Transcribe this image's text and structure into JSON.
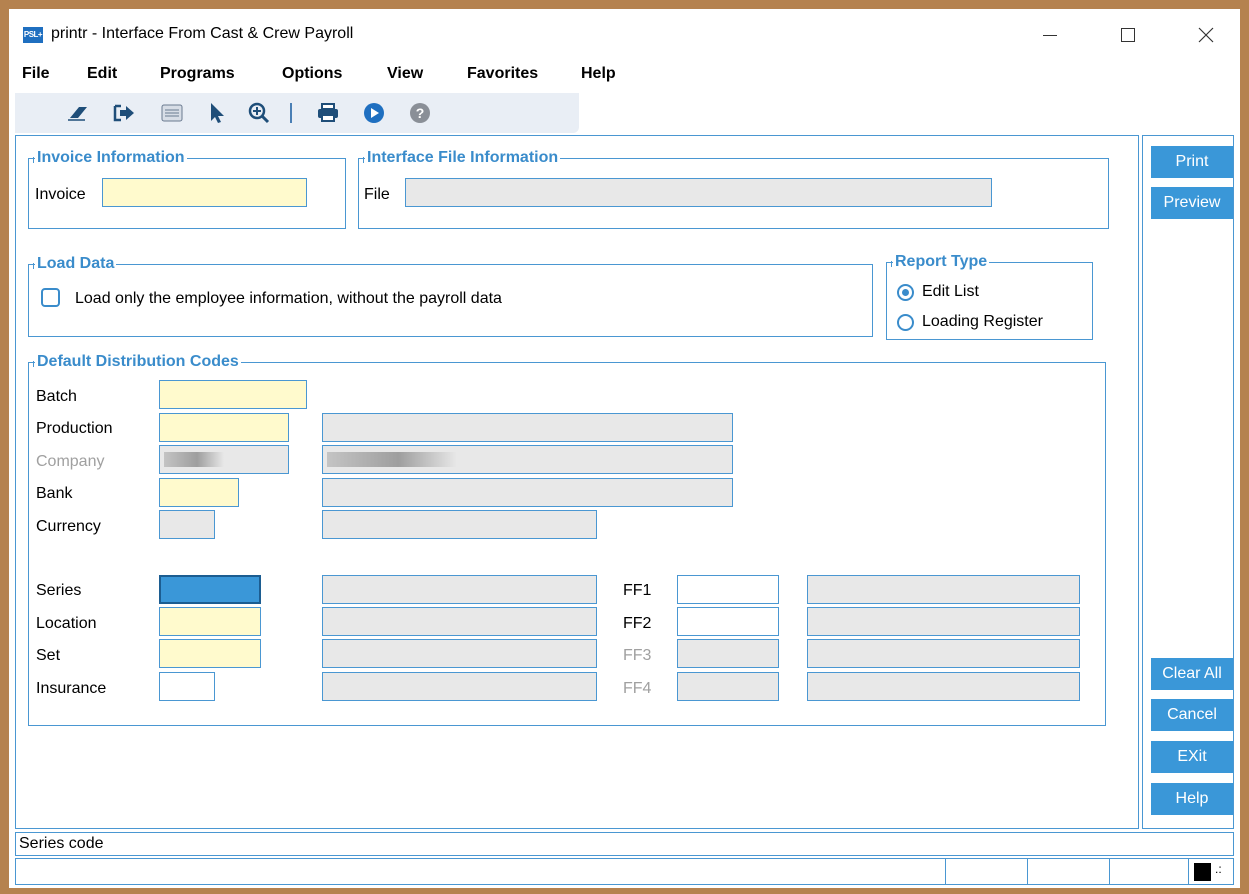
{
  "window": {
    "title": "printr - Interface From Cast & Crew Payroll",
    "app_icon_text": "PSL+"
  },
  "menu": [
    "File",
    "Edit",
    "Programs",
    "Options",
    "View",
    "Favorites",
    "Help"
  ],
  "toolbar_icons": [
    "eraser-icon",
    "exit-arrow-icon",
    "list-icon",
    "pointer-icon",
    "zoom-in-icon",
    "print-icon",
    "run-icon",
    "help-icon"
  ],
  "invoice_group": {
    "title": "Invoice Information",
    "invoice_label": "Invoice",
    "invoice_value": ""
  },
  "file_group": {
    "title": "Interface File Information",
    "file_label": "File",
    "file_value": ""
  },
  "load_group": {
    "title": "Load Data",
    "checkbox_label": "Load only the employee information, without the payroll data",
    "checked": false
  },
  "report_group": {
    "title": "Report Type",
    "options": [
      "Edit List",
      "Loading Register"
    ],
    "selected": "Edit List"
  },
  "dist_group": {
    "title": "Default Distribution Codes",
    "batch": "Batch",
    "production": "Production",
    "company": "Company",
    "bank": "Bank",
    "currency": "Currency",
    "series": "Series",
    "location": "Location",
    "set": "Set",
    "insurance": "Insurance",
    "ff1": "FF1",
    "ff2": "FF2",
    "ff3": "FF3",
    "ff4": "FF4"
  },
  "side_buttons": {
    "print": "Print",
    "preview": "Preview",
    "clear_all": "Clear All",
    "cancel": "Cancel",
    "exit": "EXit",
    "help": "Help"
  },
  "status": {
    "message": "Series code"
  },
  "colors": {
    "accent": "#3a97d8",
    "required_field": "#fffacd",
    "readonly_field": "#e8e8e8",
    "frame": "#b5824f"
  }
}
